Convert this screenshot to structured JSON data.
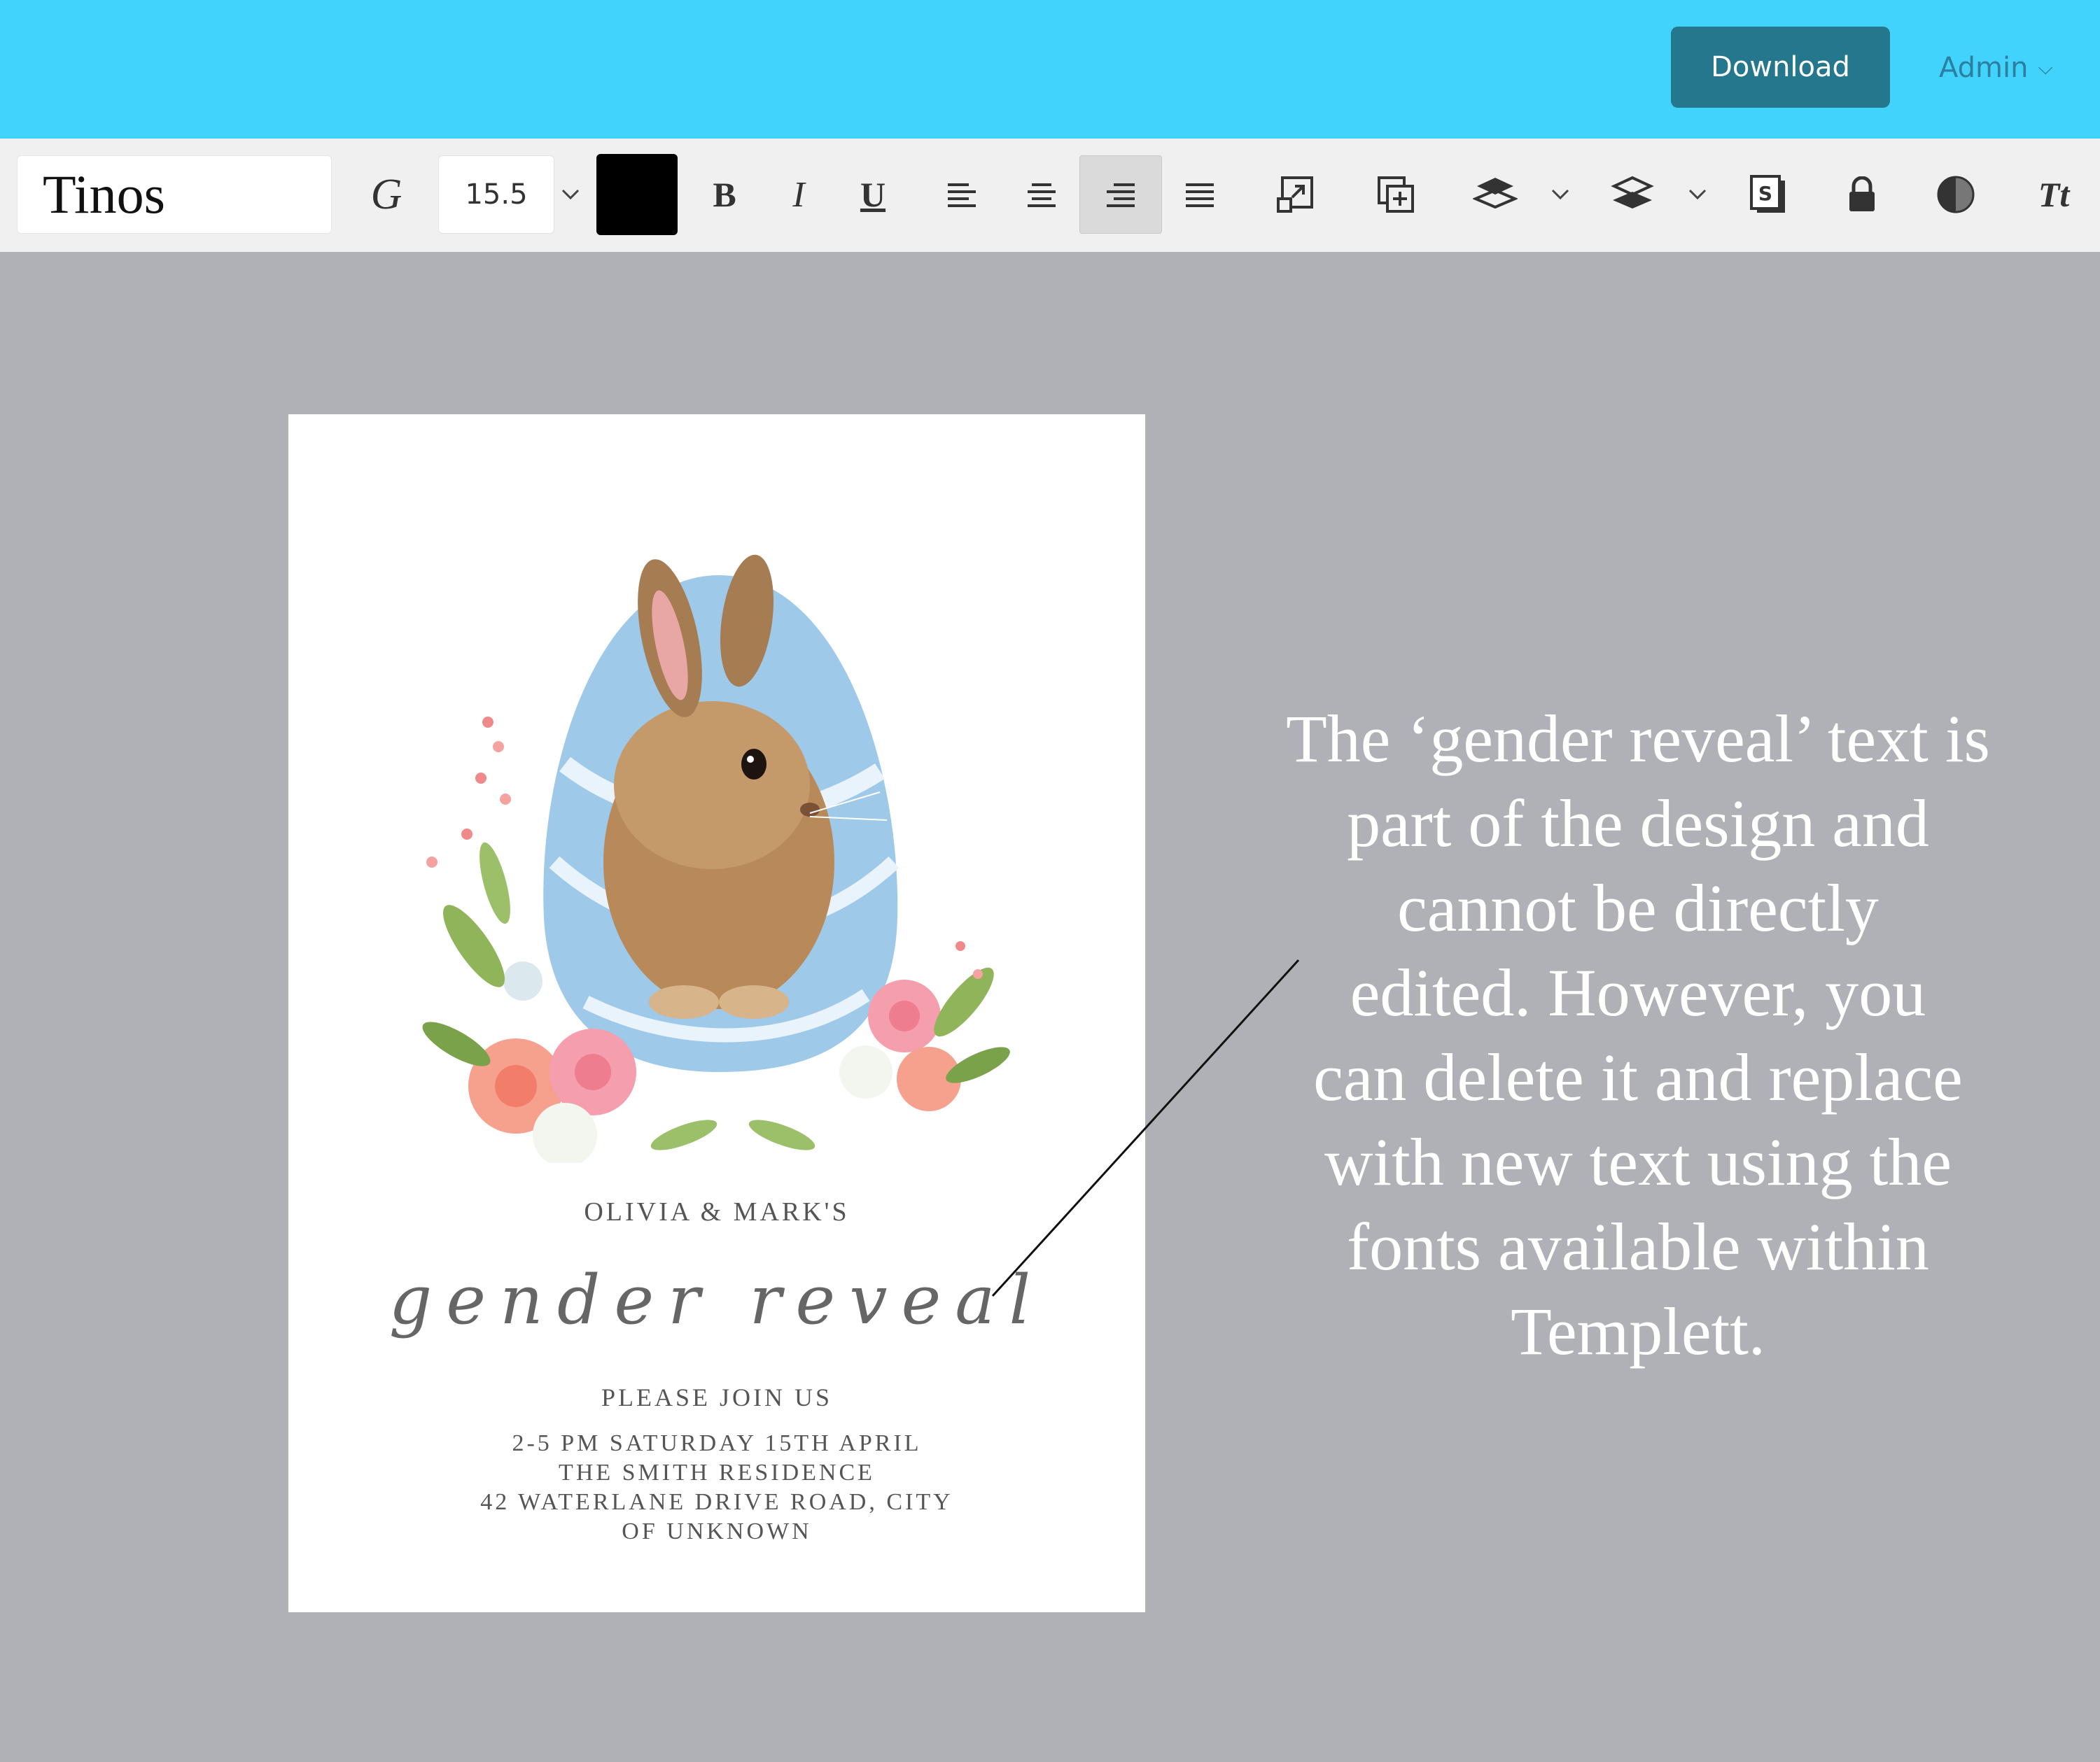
{
  "topbar": {
    "download_label": "Download",
    "user_label": "Admin"
  },
  "toolbar": {
    "font_name": "Tinos",
    "font_size": "15.5",
    "text_color": "#000000",
    "active_alignment": "align-right"
  },
  "card": {
    "hosts": "OLIVIA & MARK'S",
    "script_title": "gender reveal",
    "invite_line": "PLEASE JOIN US",
    "details": [
      "2-5 PM SATURDAY 15TH APRIL",
      "THE SMITH RESIDENCE",
      "42 WATERLANE DRIVE ROAD, CITY",
      "OF UNKNOWN"
    ]
  },
  "annotation": {
    "lines": [
      "The ‘gender reveal’ text is",
      "part of the design and",
      "cannot be directly",
      "edited. However, you",
      "can delete it and replace",
      "with new text using the",
      "fonts available within",
      "Templett."
    ]
  },
  "colors": {
    "topbar": "#42d3fd",
    "download_button": "#24778c",
    "workspace": "#b0b1b6",
    "toolbar": "#f0f0f0"
  }
}
